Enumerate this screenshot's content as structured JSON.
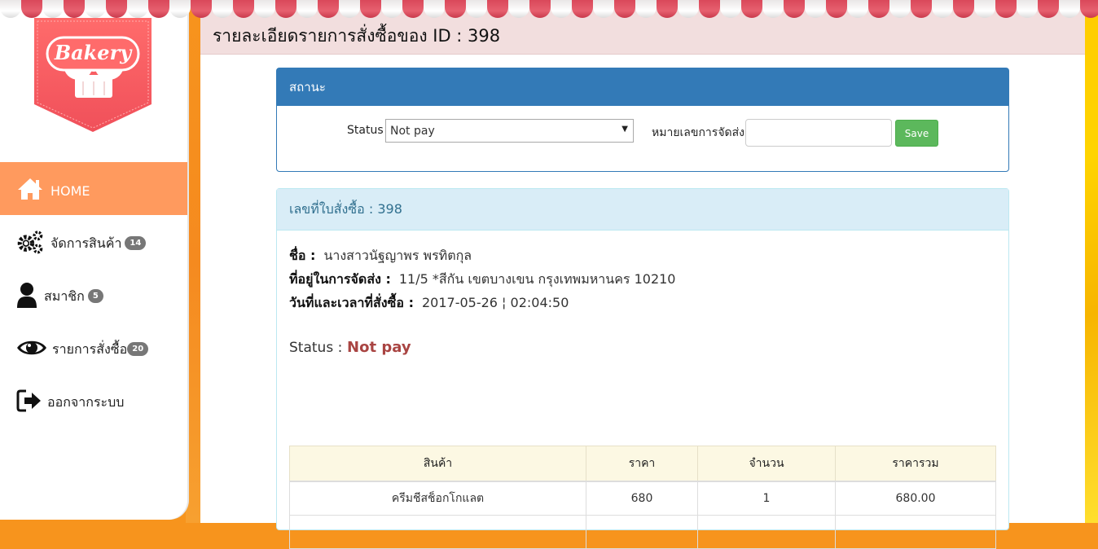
{
  "sidebar": {
    "logo_text": "Bakery",
    "items": [
      {
        "label": "HOME",
        "icon": "home-icon"
      },
      {
        "label": "จัดการสินค้า",
        "icon": "gears-icon",
        "badge": "14"
      },
      {
        "label": "สมาชิก",
        "icon": "user-icon",
        "badge": "5"
      },
      {
        "label": "รายการสั่งซื้อ",
        "icon": "eye-icon",
        "badge": "20"
      },
      {
        "label": "ออกจากระบบ",
        "icon": "sign-out-icon"
      }
    ]
  },
  "header": {
    "title": "รายละเอียดรายการสั่งซื้อของ ID : 398"
  },
  "status_panel": {
    "heading": "สถานะ",
    "status_label": "Status",
    "status_value": "Not pay",
    "tracking_label": "หมายเลขการจัดส่ง",
    "tracking_value": "",
    "save_label": "Save"
  },
  "order_panel": {
    "heading": "เลขที่ใบสั่งซื้อ : 398",
    "name_label": "ชื่อ :",
    "name_value": "นางสาวนัฐญาพร พรทิตกุล",
    "address_label": "ที่อยู่ในการจัดส่ง :",
    "address_value": "11/5 *สีกัน เขตบางเขน กรุงเทพมหานคร 10210",
    "datetime_label": "วันที่และเวลาที่สั่งซื้อ :",
    "datetime_value": "2017-05-26 ¦ 02:04:50",
    "status_label": "Status :",
    "status_value": "Not pay"
  },
  "items_table": {
    "columns": [
      "สินค้า",
      "ราคา",
      "จำนวน",
      "ราคารวม"
    ],
    "rows": [
      [
        "ครีมชีสช็อกโกแลต",
        "680",
        "1",
        "680.00"
      ]
    ]
  },
  "colors": {
    "primary": "#337ab7",
    "success": "#5cb85c",
    "info_bg": "#d9edf7",
    "danger_text": "#a94442",
    "nav_active": "#ff9a5e",
    "header_bg": "#f2dede"
  }
}
